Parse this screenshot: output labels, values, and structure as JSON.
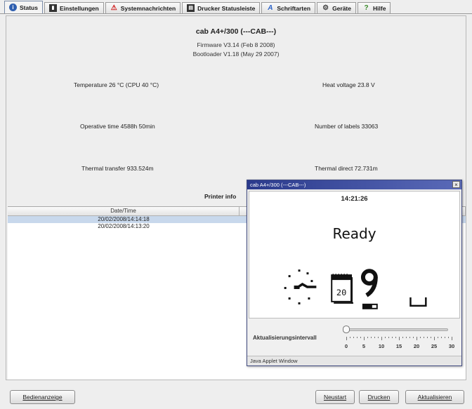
{
  "tabs": [
    {
      "label": "Status",
      "icon": "info-icon",
      "active": true
    },
    {
      "label": "Einstellungen",
      "icon": "settings-icon"
    },
    {
      "label": "Systemnachrichten",
      "icon": "warning-icon"
    },
    {
      "label": "Drucker Statusleiste",
      "icon": "printer-icon"
    },
    {
      "label": "Schriftarten",
      "icon": "font-icon"
    },
    {
      "label": "Geräte",
      "icon": "devices-icon"
    },
    {
      "label": "Hilfe",
      "icon": "help-icon"
    }
  ],
  "status": {
    "printer_name": "cab A4+/300 (---CAB---)",
    "firmware": "Firmware V3.14 (Feb  8 2008)",
    "bootloader": "Bootloader V1.18 (May 29 2007)",
    "temperature": "Temperature 26 °C (CPU 40 °C)",
    "heat_voltage": "Heat voltage 23.8 V",
    "operative_time": "Operative time 4588h 50min",
    "number_of_labels": "Number of labels 33063",
    "thermal_transfer": "Thermal transfer 933.524m",
    "thermal_direct": "Thermal direct 72.731m",
    "printer_info_label": "Printer info"
  },
  "table": {
    "header": "Date/Time",
    "rows": [
      "20/02/2008/14:14:18",
      "20/02/2008/14:13:20"
    ]
  },
  "buttons": {
    "bedienanzeige": "Bedienanzeige",
    "neustart": "Neustart",
    "drucken": "Drucken",
    "aktualisieren": "Aktualisieren"
  },
  "popup": {
    "title": "cab A4+/300 (---CAB---)",
    "close_glyph": "×",
    "time": "14:21:26",
    "state": "Ready",
    "calendar_day": "20",
    "interval_label": "Aktualisierungsintervall",
    "interval_value": 0,
    "interval_ticks": [
      "0",
      "5",
      "10",
      "15",
      "20",
      "25",
      "30"
    ],
    "footer": "Java Applet Window"
  }
}
